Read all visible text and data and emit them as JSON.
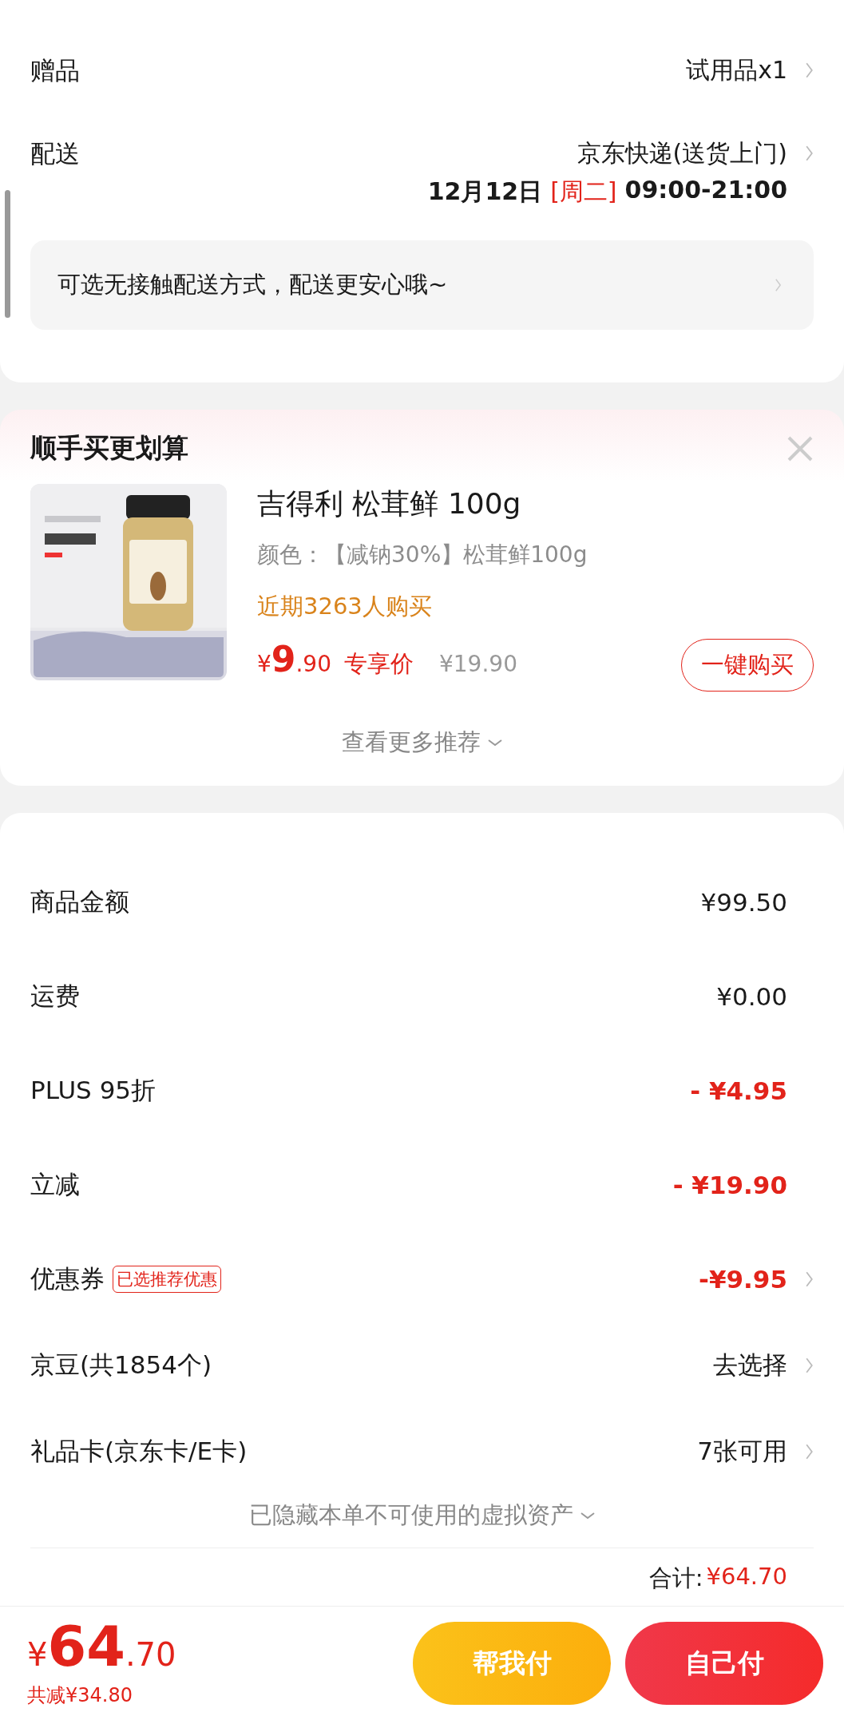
{
  "delivery_card": {
    "rows": [
      {
        "label": "赠品",
        "value": "试用品x1"
      },
      {
        "label": "配送",
        "value": "京东快递(送货上门)",
        "date": "12月12日",
        "weekday": "[周二]",
        "time": "09:00-21:00"
      }
    ],
    "notice": "可选无接触配送方式，配送更安心哦~"
  },
  "recommend": {
    "title": "顺手买更划算",
    "product": {
      "name": "吉得利 松茸鲜 100g",
      "variant": "颜色：【减钠30%】松茸鲜100g",
      "sales": "近期3263人购买",
      "price_symbol": "¥",
      "price_int": "9",
      "price_dec": ".90",
      "price_tag": "专享价",
      "original_price": "¥19.90",
      "buy_button": "一键购买"
    },
    "more": "查看更多推荐"
  },
  "summary": {
    "rows": [
      {
        "label": "商品金额",
        "value": "¥99.50",
        "kind": "plain",
        "arrow": false
      },
      {
        "label": "运费",
        "value": "¥0.00",
        "kind": "plain",
        "arrow": false
      },
      {
        "label": "PLUS 95折",
        "value": "- ¥4.95",
        "kind": "discount",
        "arrow": false
      },
      {
        "label": "立减",
        "value": "- ¥19.90",
        "kind": "discount",
        "arrow": false
      },
      {
        "label": "优惠券",
        "badge": "已选推荐优惠",
        "value": "-¥9.95",
        "kind": "discount",
        "arrow": true
      },
      {
        "label": "京豆(共1854个)",
        "value": "去选择",
        "kind": "plain",
        "arrow": true
      },
      {
        "label": "礼品卡(京东卡/E卡)",
        "value": "7张可用",
        "kind": "plain",
        "arrow": true
      }
    ],
    "hidden_note": "已隐藏本单不可使用的虚拟资产",
    "total_label": "合计:",
    "total_value": "¥64.70"
  },
  "footer": {
    "price_symbol": "¥",
    "price_int": "64",
    "price_dec": ".70",
    "saved": "共减¥34.80",
    "buttons": [
      {
        "label": "帮我付",
        "kind": "secondary"
      },
      {
        "label": "自己付",
        "kind": "primary"
      }
    ]
  }
}
